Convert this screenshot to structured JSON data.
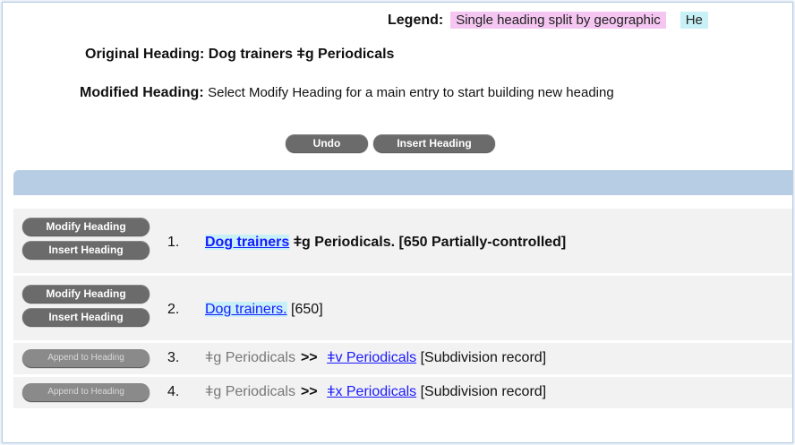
{
  "legend": {
    "label": "Legend:",
    "item1": "Single heading split by geographic",
    "item2": "He"
  },
  "original": {
    "label": "Original Heading:",
    "value": "Dog trainers ǂg Periodicals"
  },
  "modified": {
    "label": "Modified Heading:",
    "value": "Select Modify Heading for a main entry to start building new heading"
  },
  "toolbar": {
    "undo_label": "Undo",
    "insert_label": "Insert Heading"
  },
  "rows": [
    {
      "modify_label": "Modify Heading",
      "insert_label": "Insert Heading",
      "number": "1.",
      "link": "Dog trainers",
      "rest": "ǂg Periodicals. [650 Partially-controlled]"
    },
    {
      "modify_label": "Modify Heading",
      "insert_label": "Insert Heading",
      "number": "2.",
      "link": "Dog trainers.",
      "rest": "[650]"
    },
    {
      "append_label": "Append to Heading",
      "number": "3.",
      "prefix": "ǂg Periodicals",
      "arrows": ">>",
      "link": "ǂv Periodicals",
      "rest": "[Subdivision record]"
    },
    {
      "append_label": "Append to Heading",
      "number": "4.",
      "prefix": "ǂg Periodicals",
      "arrows": ">>",
      "link": "ǂx Periodicals",
      "rest": "[Subdivision record]"
    }
  ],
  "colors": {
    "accent_bar": "#b6cde3",
    "button_bg": "#6b6b6b",
    "link": "#1a1aff",
    "legend_pink": "#f5c6f2",
    "legend_cyan": "#c8f1f7"
  }
}
